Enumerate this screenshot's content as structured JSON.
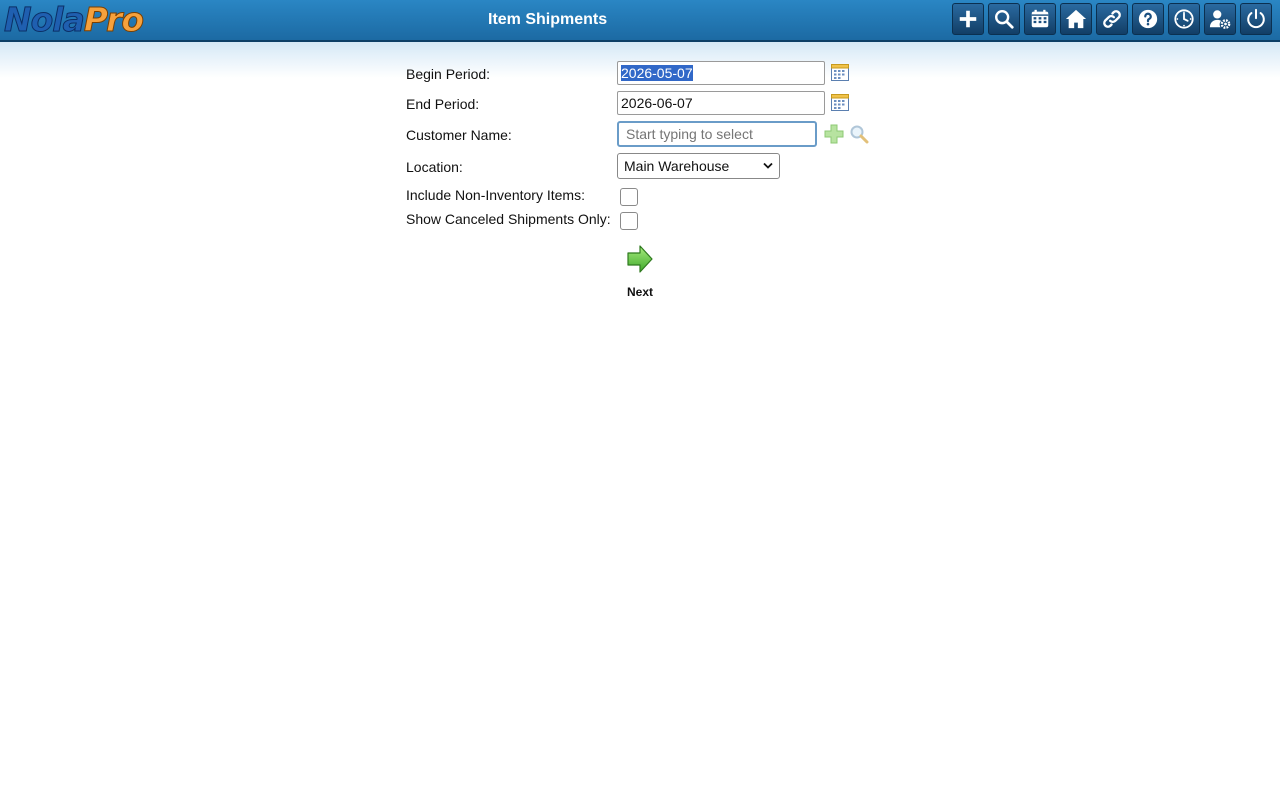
{
  "app": {
    "logo_part1": "Nola",
    "logo_part2": "Pro",
    "page_title": "Item Shipments"
  },
  "toolbar": {
    "buttons": [
      {
        "name": "add",
        "icon": "plus-icon"
      },
      {
        "name": "search",
        "icon": "search-icon"
      },
      {
        "name": "calendar",
        "icon": "calendar-icon"
      },
      {
        "name": "home",
        "icon": "home-icon"
      },
      {
        "name": "links",
        "icon": "link-icon"
      },
      {
        "name": "help",
        "icon": "help-icon"
      },
      {
        "name": "history",
        "icon": "clock-icon"
      },
      {
        "name": "user-settings",
        "icon": "user-gear-icon"
      },
      {
        "name": "logout",
        "icon": "power-icon"
      }
    ]
  },
  "form": {
    "begin_period": {
      "label": "Begin Period:",
      "value": "2026-05-07"
    },
    "end_period": {
      "label": "End Period:",
      "value": "2026-06-07"
    },
    "customer_name": {
      "label": "Customer Name:",
      "value": "",
      "placeholder": "Start typing to select"
    },
    "location": {
      "label": "Location:",
      "selected": "Main Warehouse"
    },
    "include_non_inventory": {
      "label": "Include Non-Inventory Items:",
      "checked": false
    },
    "show_canceled_only": {
      "label": "Show Canceled Shipments Only:",
      "checked": false
    },
    "next": {
      "label": "Next"
    }
  },
  "colors": {
    "header": "#1f73b0",
    "accent_green": "#5cc23a",
    "selection": "#3168c8"
  }
}
